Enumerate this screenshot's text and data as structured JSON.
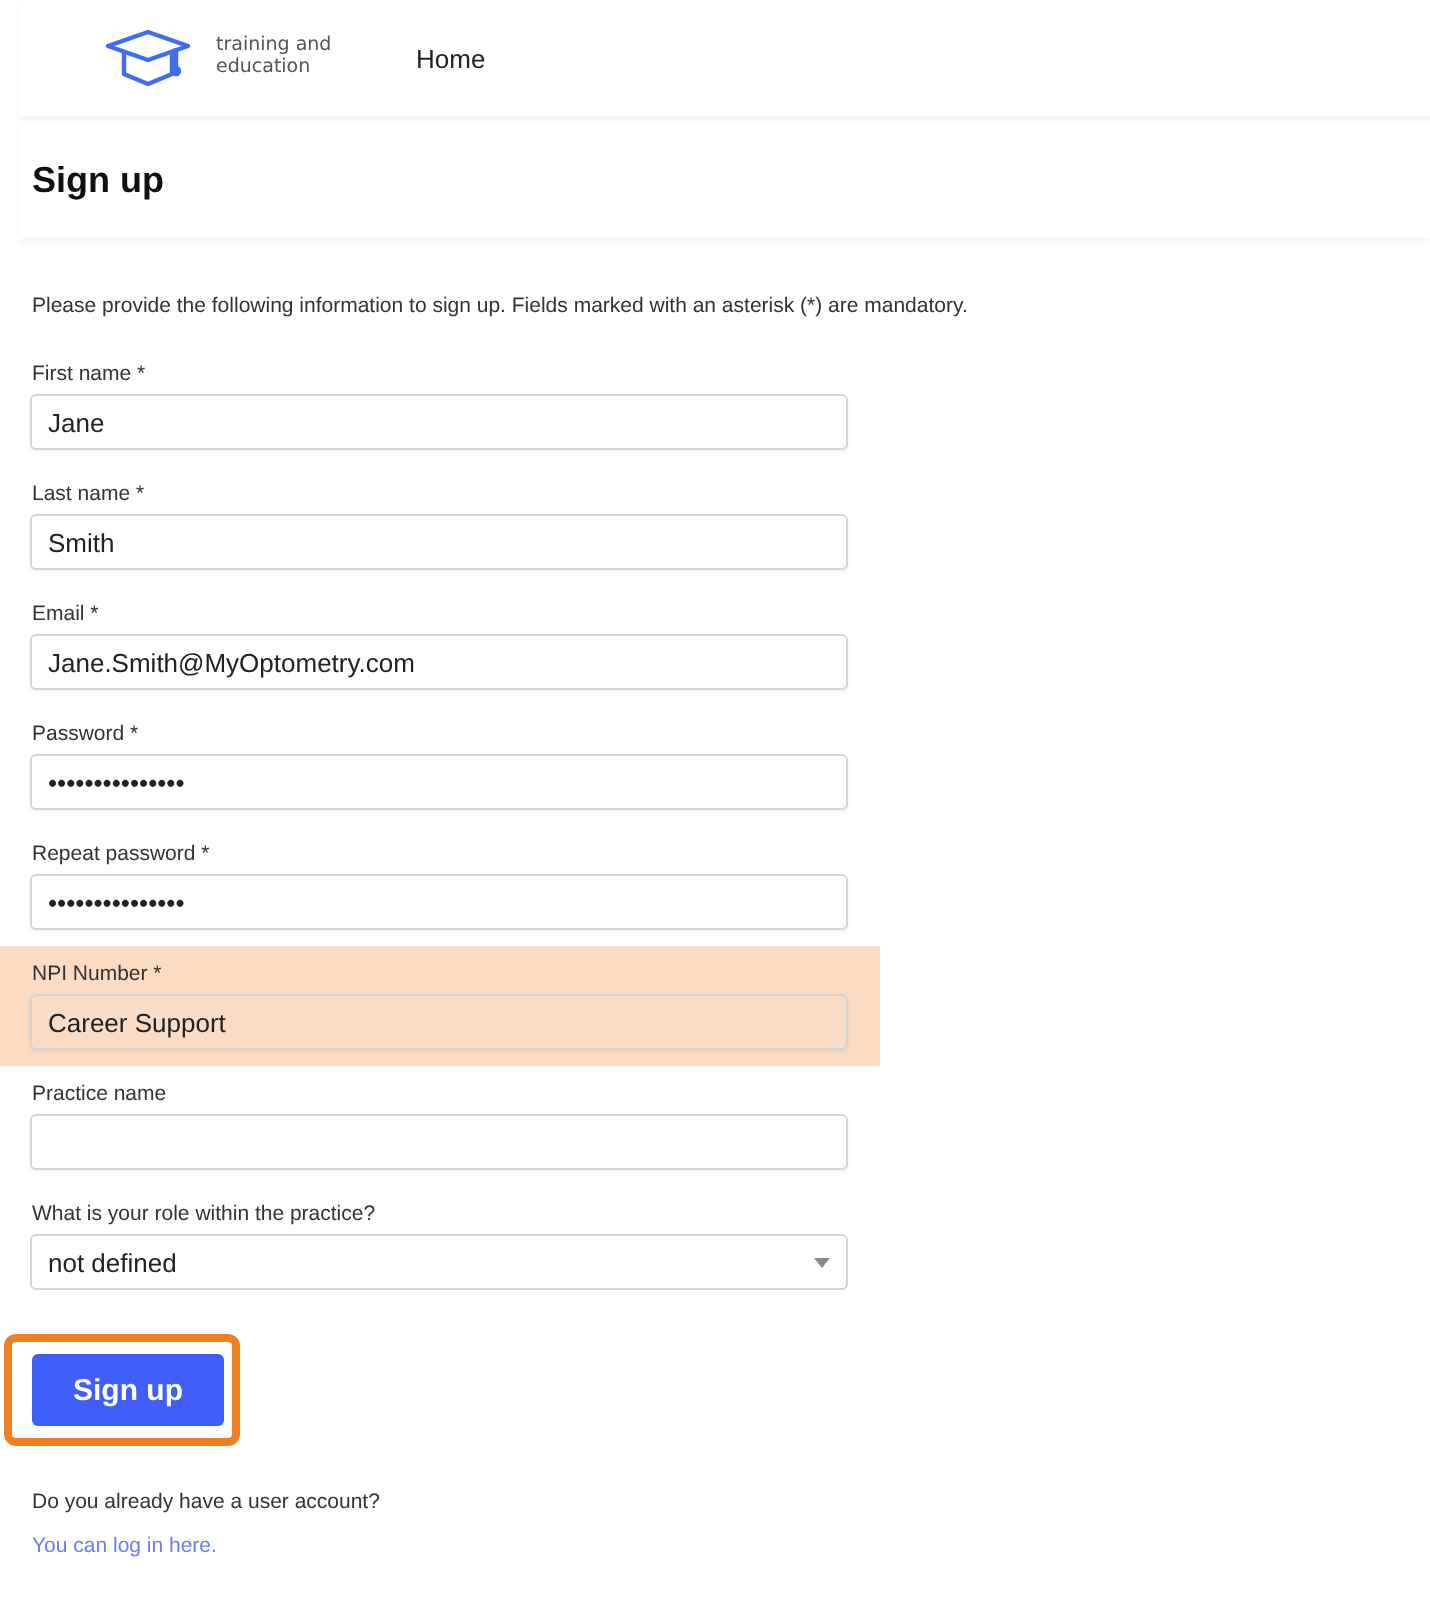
{
  "header": {
    "logo_text": "training and education",
    "nav": [
      {
        "label": "Home"
      }
    ]
  },
  "title": "Sign up",
  "intro": "Please provide the following information to sign up. Fields marked with an asterisk (*) are mandatory.",
  "fields": [
    {
      "kind": "text",
      "label": "First name *",
      "value": "Jane",
      "highlighted": false
    },
    {
      "kind": "text",
      "label": "Last name *",
      "value": "Smith",
      "highlighted": false
    },
    {
      "kind": "text",
      "label": "Email *",
      "value": "Jane.Smith@MyOptometry.com",
      "highlighted": false
    },
    {
      "kind": "password",
      "label": "Password *",
      "value": "•••••••••••••••",
      "highlighted": false
    },
    {
      "kind": "password",
      "label": "Repeat password *",
      "value": "•••••••••••••••",
      "highlighted": false
    },
    {
      "kind": "text",
      "label": "NPI Number *",
      "value": "Career Support",
      "highlighted": true
    },
    {
      "kind": "text",
      "label": "Practice name",
      "highlighted": false
    },
    {
      "kind": "select",
      "label": "What is your role within the practice?",
      "value": "not defined",
      "highlighted": false
    }
  ],
  "submit": {
    "label": "Sign up",
    "highlighted": true
  },
  "account_prompt": "Do you already have a user account?",
  "login_link": "You can log in here."
}
